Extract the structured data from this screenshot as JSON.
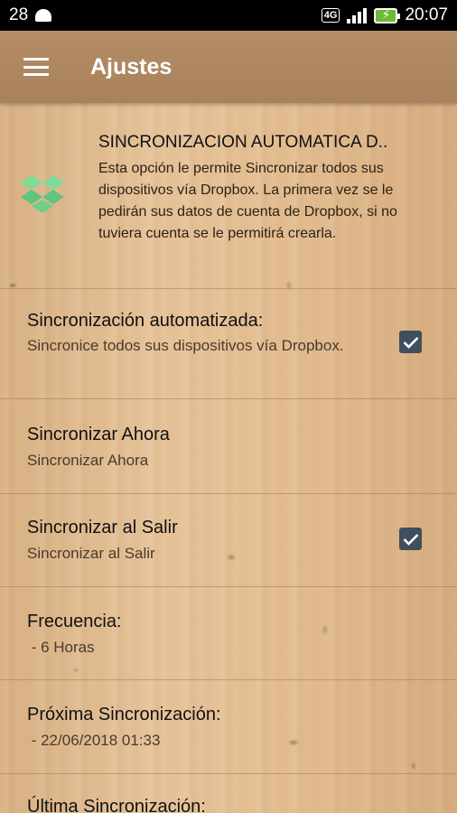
{
  "status_bar": {
    "left_text": "28",
    "network_badge": "4G",
    "time": "20:07",
    "icons": [
      "android-icon",
      "signal-icon",
      "battery-charging-icon"
    ]
  },
  "app_bar": {
    "title": "Ajustes",
    "menu_icon": "hamburger-menu-icon"
  },
  "intro": {
    "icon": "dropbox-icon",
    "title": "SINCRONIZACION AUTOMATICA D..",
    "description": "Esta opción le permite Sincronizar todos sus dispositivos vía Dropbox. La primera vez se le pedirán sus datos de cuenta de Dropbox, si no tuviera cuenta se le permitirá crearla."
  },
  "preferences": [
    {
      "title": "Sincronización automatizada:",
      "summary": "Sincronice todos sus dispositivos vía Dropbox.",
      "checked": true
    },
    {
      "title": "Sincronizar Ahora",
      "summary": "Sincronizar Ahora"
    },
    {
      "title": "Sincronizar al Salir",
      "summary": "Sincronizar al Salir",
      "checked": true
    },
    {
      "title": "Frecuencia:",
      "summary": " - 6 Horas"
    },
    {
      "title": "Próxima Sincronización:",
      "summary": " - 22/06/2018 01:33"
    },
    {
      "title": "Última Sincronización:"
    }
  ],
  "colors": {
    "app_bar": "#ab845e",
    "checkbox": "#3f4f5d",
    "dropbox": "#6fcf8a"
  }
}
